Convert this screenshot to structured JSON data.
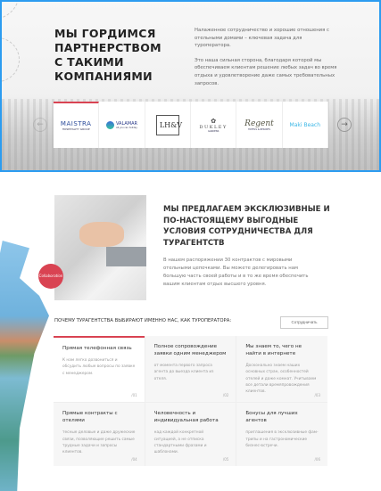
{
  "partners": {
    "title_lines": [
      "Мы гордимся",
      "партнерством",
      "с такими",
      "компаниями"
    ],
    "para1": "Налаженное сотрудничество и хорошие отношения с отельными домами – ключевая задача для туроператора.",
    "para2": "Это наша сильная сторона, благодаря которой мы обеспечиваем клиентам решение любых задач во время отдыха и удовлетворение даже самых требовательных запросов.",
    "logos": [
      {
        "name": "MAISTRA",
        "sub": "HOSPITALITY GROUP"
      },
      {
        "name": "VALAMAR",
        "sub": "All you can holiday"
      },
      {
        "name": "LH&V",
        "sub": ""
      },
      {
        "name": "DUKLEY",
        "sub": "GARDENS"
      },
      {
        "name": "Regent",
        "sub": "HOTELS & RESORTS"
      },
      {
        "name": "Maki Beach",
        "sub": ""
      }
    ],
    "prev": "←",
    "next": "→"
  },
  "offer": {
    "title": "Мы предлагаем эксклюзивные и по-настоящему выгодные условия сотрудничества для турагентств",
    "para": "В нашем распоряжении 30 контрактов с мировыми отельными цепочками. Вы можете делегировать нам большую часть своей работы и в то же время обеспечить вашим клиентам отдых высшего уровня.",
    "badge": "Collaboration"
  },
  "why": {
    "title": "Почему турагентства выбирают именно нас, как туроператора:",
    "button": "Сотрудничать",
    "cards": [
      {
        "title": "Прямая телефонная связь",
        "text": "К нам легко дозвониться и обсудить любые вопросы по заявке с менеджером.",
        "num": "/01"
      },
      {
        "title": "Полное сопровождение заявки одним менеджером",
        "text": "от момента первого запроса агента до выезда клиента из отеля.",
        "num": "/02"
      },
      {
        "title": "Мы знаем то, чего не найти в интернете",
        "text": "Досконально знаем наших основных стран, особенностей отелей и даже комнат. Учитываем все детали времяпровождения клиентов.",
        "num": "/03"
      },
      {
        "title": "Прямые контракты с отелями",
        "text": "тесные деловые и даже дружеские связи, позволяющие решить самые трудные задачи и запросы клиентов.",
        "num": "/04"
      },
      {
        "title": "Человечность и индивидуальная работа",
        "text": "над каждой конкретной ситуацией, а не отписка стандартными фразами и шаблонами.",
        "num": "/05"
      },
      {
        "title": "Бонусы для лучших агентов",
        "text": "приглашения в эксклюзивные фам-трипы и на гастрономические бизнес-встречи.",
        "num": "/06"
      }
    ]
  }
}
